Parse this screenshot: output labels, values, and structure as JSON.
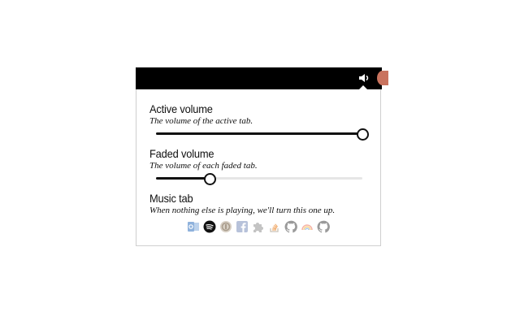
{
  "active_volume": {
    "title": "Active volume",
    "description": "The volume of the active tab.",
    "value": 1.0
  },
  "faded_volume": {
    "title": "Faded volume",
    "description": "The volume of each faded tab.",
    "value": 0.26
  },
  "music_tab": {
    "title": "Music tab",
    "description": "When nothing else is playing, we'll turn this one up.",
    "services": [
      {
        "name": "outlook-icon",
        "selected": false
      },
      {
        "name": "spotify-icon",
        "selected": true
      },
      {
        "name": "audio-circle-icon",
        "selected": false
      },
      {
        "name": "facebook-icon",
        "selected": false
      },
      {
        "name": "puzzle-icon",
        "selected": false
      },
      {
        "name": "stack-overflow-icon",
        "selected": false
      },
      {
        "name": "github-icon",
        "selected": false
      },
      {
        "name": "rainbow-icon",
        "selected": false
      },
      {
        "name": "github-icon",
        "selected": false
      }
    ]
  },
  "colors": {
    "toolbar": "#000000",
    "accent": "#111111",
    "track": "#e6e6e6"
  }
}
